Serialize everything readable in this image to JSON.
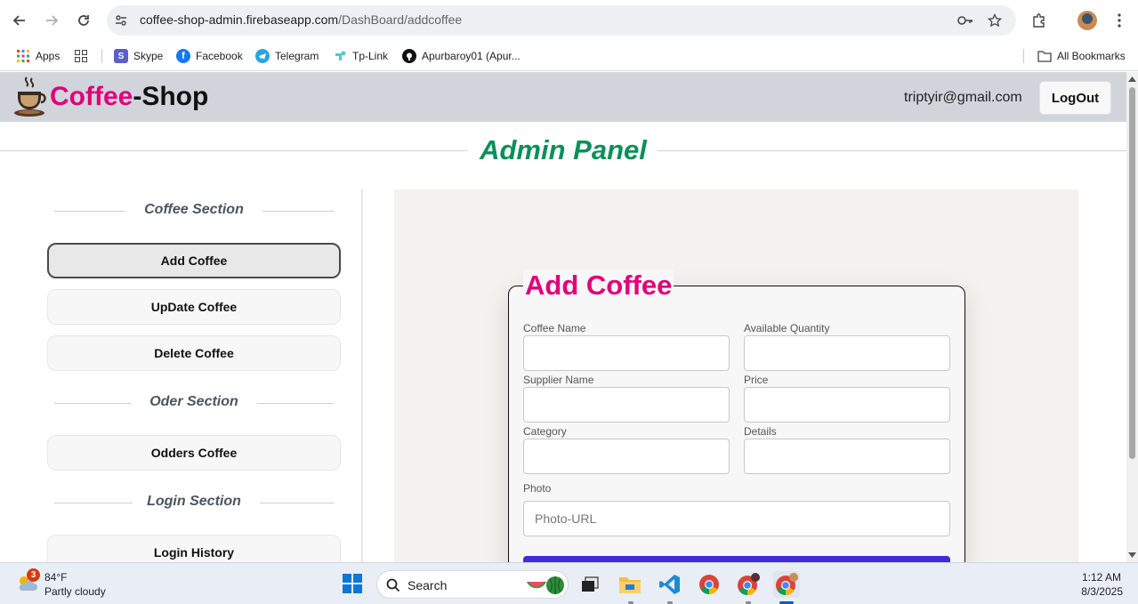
{
  "browser": {
    "url_host": "coffee-shop-admin.firebaseapp.com",
    "url_path": "/DashBoard/addcoffee",
    "bookmarks": [
      {
        "label": "Apps",
        "icon": "apps-grid-icon"
      },
      {
        "label": "",
        "icon": "grid-icon"
      },
      {
        "label": "Skype",
        "icon": "skype-icon"
      },
      {
        "label": "Facebook",
        "icon": "facebook-icon"
      },
      {
        "label": "Telegram",
        "icon": "telegram-icon"
      },
      {
        "label": "Tp-Link",
        "icon": "tplink-icon"
      },
      {
        "label": "Apurbaroy01 (Apur...",
        "icon": "github-icon"
      }
    ],
    "all_bookmarks": "All Bookmarks"
  },
  "header": {
    "brand_part1": "Coffee",
    "brand_part2": "-Shop",
    "user_email": "triptyir@gmail.com",
    "logout_label": "LogOut"
  },
  "page_title": "Admin Panel",
  "sidebar": {
    "coffee_section": "Coffee Section",
    "add_coffee": "Add Coffee",
    "update_coffee": "UpDate Coffee",
    "delete_coffee": "Delete Coffee",
    "order_section": "Oder Section",
    "orders_coffee": "Odders Coffee",
    "login_section": "Login Section",
    "login_history": "Login History"
  },
  "form": {
    "title": "Add Coffee",
    "coffee_name_label": "Coffee Name",
    "available_quantity_label": "Available Quantity",
    "supplier_name_label": "Supplier Name",
    "price_label": "Price",
    "category_label": "Category",
    "details_label": "Details",
    "photo_label": "Photo",
    "photo_placeholder": "Photo-URL"
  },
  "taskbar": {
    "weather_badge": "3",
    "temperature": "84°F",
    "condition": "Partly cloudy",
    "search_label": "Search",
    "time": "1:12 AM",
    "date": "8/3/2025"
  },
  "colors": {
    "brand_pink": "#e0007a",
    "admin_green": "#0a8f5a",
    "submit_blue": "#3f2bd8",
    "header_gray": "#d1d5db"
  }
}
